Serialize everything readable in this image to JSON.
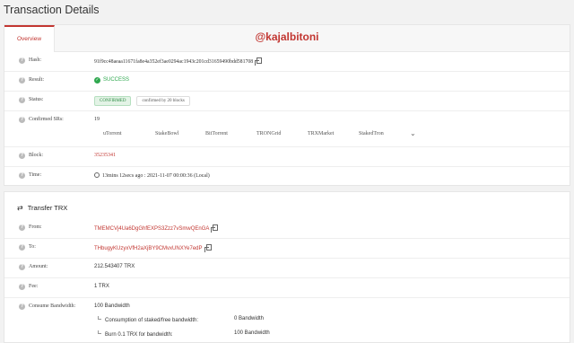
{
  "page": {
    "title": "Transaction Details"
  },
  "tabs": [
    {
      "label": "Overview",
      "active": true
    }
  ],
  "watermark": "@kajalbitoni",
  "details": {
    "hash": {
      "label": "Hash:",
      "value": "91f9cc48aeaa11671fa8e4a352ef3ae0294ac1943c201cd31659490bdd581708"
    },
    "result": {
      "label": "Result:",
      "value": "SUCCESS"
    },
    "status": {
      "label": "Status:",
      "badge": "CONFIRMED",
      "blocks": "confirmed by 20 blocks"
    },
    "confirmed_srs": {
      "label": "Confirmed SRs:",
      "count": "19",
      "items": [
        "uTorrent",
        "StakeBowl",
        "BitTorrent",
        "TRONGrid",
        "TRXMarket",
        "StakedTron"
      ]
    },
    "block": {
      "label": "Block:",
      "value": "35235341"
    },
    "time": {
      "label": "Time:",
      "value": "13mins 12secs ago : 2021-11-07 00:00:36 (Local)"
    }
  },
  "transfer": {
    "title": "Transfer TRX",
    "from": {
      "label": "From:",
      "value": "TMEMCVj4Ua6DgGhfEXPS3Zzz7vSmwQEnGA"
    },
    "to": {
      "label": "To:",
      "value": "THbugyKUzyxVfH2aXjBY9CMvxUNXYe7edP"
    },
    "amount": {
      "label": "Amount:",
      "value": "212.543407 TRX"
    },
    "fee": {
      "label": "Fee:",
      "value": "1 TRX"
    },
    "bandwidth": {
      "label": "Consume Bandwidth:",
      "value": "100 Bandwidth",
      "rows": [
        {
          "label": "Consumption of staked/free bandwidth:",
          "value": "0 Bandwidth"
        },
        {
          "label": "Burn 0.1 TRX for bandwidth:",
          "value": "100 Bandwidth"
        }
      ]
    }
  },
  "colors": {
    "accent": "#c23631",
    "success": "#2fa84f"
  },
  "icons": {
    "help": "question-icon",
    "copy": "copy-icon",
    "success": "check-circle-icon",
    "time": "clock-icon",
    "transfer": "arrows-exchange-icon",
    "expand": "chevron-down-icon"
  }
}
